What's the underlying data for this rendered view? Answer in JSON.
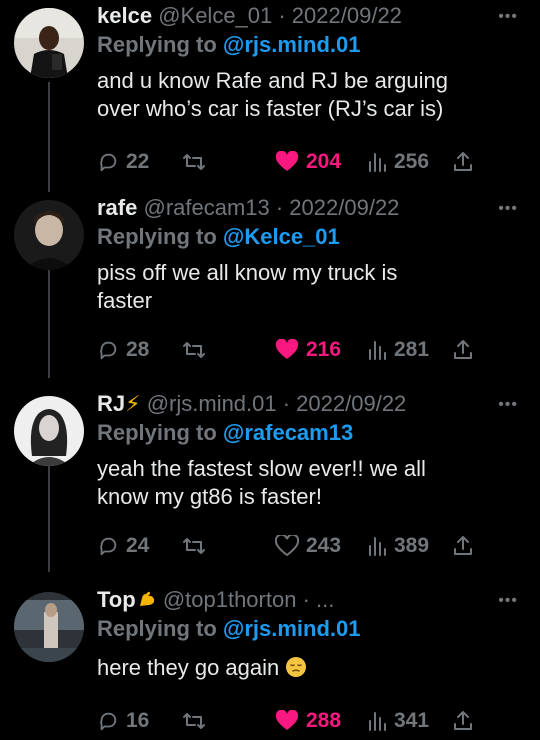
{
  "tweets": [
    {
      "name": "kelce",
      "handle_date": "@Kelce_01 · 2022/09/22",
      "replying_prefix": "Replying to ",
      "replying_to": "@rjs.mind.01",
      "text": "and u know Rafe and RJ be arguing\nover who’s car is faster (RJ’s car is)",
      "replies": "22",
      "likes": "204",
      "liked": true,
      "views": "256"
    },
    {
      "name": "rafe",
      "handle_date": "@rafecam13 · 2022/09/22",
      "replying_prefix": "Replying to ",
      "replying_to": "@Kelce_01",
      "text": "piss off we all know my truck is\nfaster",
      "replies": "28",
      "likes": "216",
      "liked": true,
      "views": "281"
    },
    {
      "name": "RJ",
      "handle_date": "@rjs.mind.01 · 2022/09/22",
      "replying_prefix": "Replying to ",
      "replying_to": "@rafecam13",
      "text": "yeah the fastest slow ever!! we all\nknow my gt86 is faster!",
      "replies": "24",
      "likes": "243",
      "liked": false,
      "views": "389"
    },
    {
      "name": "Top",
      "handle_date": "@top1thorton · ...",
      "replying_prefix": "Replying to ",
      "replying_to": "@rjs.mind.01",
      "text": "here they go again",
      "replies": "16",
      "likes": "288",
      "liked": true,
      "views": "341"
    }
  ],
  "icons": {
    "reply": "reply-bubble-icon",
    "retweet": "retweet-icon",
    "like": "heart-icon",
    "views": "views-bar-icon",
    "share": "share-icon",
    "more": "more-dots-icon"
  },
  "colors": {
    "background": "#000000",
    "text": "#e7e9ea",
    "muted": "#71767b",
    "link": "#1d9bf0",
    "like": "#f91880"
  }
}
